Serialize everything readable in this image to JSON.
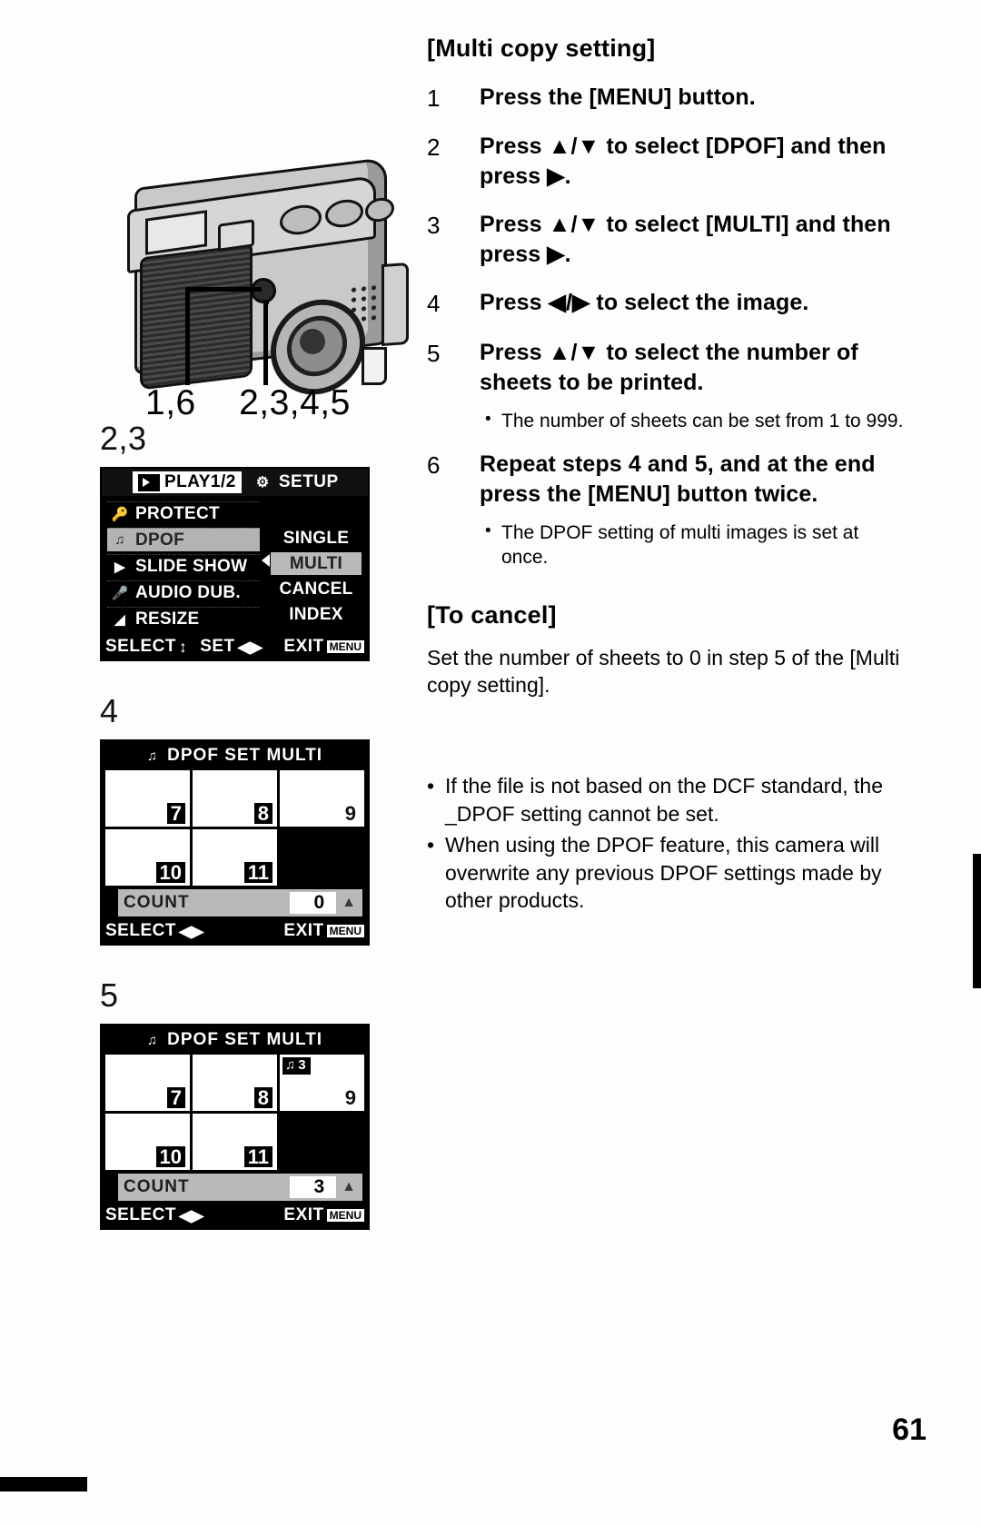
{
  "page": {
    "number": "61"
  },
  "figures": {
    "camera": {
      "label": "camera-rear-illustration",
      "callout_left": "1,6",
      "callout_right": "2,3,4,5"
    },
    "menu_screen": {
      "step_label": "2,3",
      "tabs": [
        {
          "icon": "play-icon",
          "label": "PLAY1/2",
          "selected": true
        },
        {
          "icon": "setup-tool-icon",
          "label": "SETUP",
          "selected": false
        }
      ],
      "items": [
        {
          "icon": "key-icon",
          "label": "PROTECT",
          "selected": false
        },
        {
          "icon": "dpof-icon",
          "label": "DPOF",
          "selected": true
        },
        {
          "icon": "slideshow-icon",
          "label": "SLIDE SHOW",
          "selected": false
        },
        {
          "icon": "microphone-icon",
          "label": "AUDIO DUB.",
          "selected": false
        },
        {
          "icon": "resize-icon",
          "label": "RESIZE",
          "selected": false
        }
      ],
      "options": [
        {
          "label": "SINGLE",
          "selected": false
        },
        {
          "label": "MULTI",
          "selected": true
        },
        {
          "label": "CANCEL",
          "selected": false
        },
        {
          "label": "INDEX",
          "selected": false
        }
      ],
      "footer": {
        "select_label": "SELECT",
        "select_glyph": "↕",
        "set_label": "SET",
        "set_glyph": "◀▶",
        "exit_label": "EXIT",
        "exit_badge": "MENU"
      }
    },
    "dpof_screen_4": {
      "step_label": "4",
      "icon": "dpof-icon",
      "title": "DPOF SET MULTI",
      "thumbnails": [
        {
          "number": "7",
          "cursor": false,
          "copies": ""
        },
        {
          "number": "8",
          "cursor": false,
          "copies": ""
        },
        {
          "number": "9",
          "cursor": true,
          "copies": ""
        },
        {
          "number": "10",
          "cursor": false,
          "copies": ""
        },
        {
          "number": "11",
          "cursor": false,
          "copies": ""
        }
      ],
      "count_label": "COUNT",
      "count_value": "0",
      "footer": {
        "select_label": "SELECT",
        "select_glyph": "◀▶",
        "exit_label": "EXIT",
        "exit_badge": "MENU"
      }
    },
    "dpof_screen_5": {
      "step_label": "5",
      "icon": "dpof-icon",
      "title": "DPOF SET MULTI",
      "thumbnails": [
        {
          "number": "7",
          "cursor": false,
          "copies": ""
        },
        {
          "number": "8",
          "cursor": false,
          "copies": ""
        },
        {
          "number": "9",
          "cursor": true,
          "copies": "3"
        },
        {
          "number": "10",
          "cursor": false,
          "copies": ""
        },
        {
          "number": "11",
          "cursor": false,
          "copies": ""
        }
      ],
      "count_label": "COUNT",
      "count_value": "3",
      "footer": {
        "select_label": "SELECT",
        "select_glyph": "◀▶",
        "exit_label": "EXIT",
        "exit_badge": "MENU"
      }
    }
  },
  "content": {
    "heading": "[Multi copy setting]",
    "steps": [
      {
        "num": "1",
        "text": "Press the [MENU] button."
      },
      {
        "num": "2",
        "text": "Press ▲/▼ to select [DPOF] and then press ▶."
      },
      {
        "num": "3",
        "text": "Press ▲/▼ to select [MULTI] and then press ▶."
      },
      {
        "num": "4",
        "text": "Press ◀/▶ to select the image."
      },
      {
        "num": "5",
        "text": "Press ▲/▼ to select the number of sheets to be printed."
      },
      {
        "num": "6",
        "text": "Repeat steps 4 and 5, and at the end press the [MENU] button twice."
      }
    ],
    "note_after_step5": "The number of sheets can be set from 1 to 999.",
    "note_after_step6": "The DPOF setting of multi images is set at once.",
    "cancel_heading": "[To cancel]",
    "cancel_text": "Set the number of sheets to 0 in step 5 of the [Multi copy setting].",
    "tail_notes": [
      "If the file is not based on the DCF standard, the _DPOF setting cannot be set.",
      "When using the DPOF feature, this camera will overwrite any previous DPOF settings made by other products."
    ],
    "bullet_glyph": "•"
  }
}
